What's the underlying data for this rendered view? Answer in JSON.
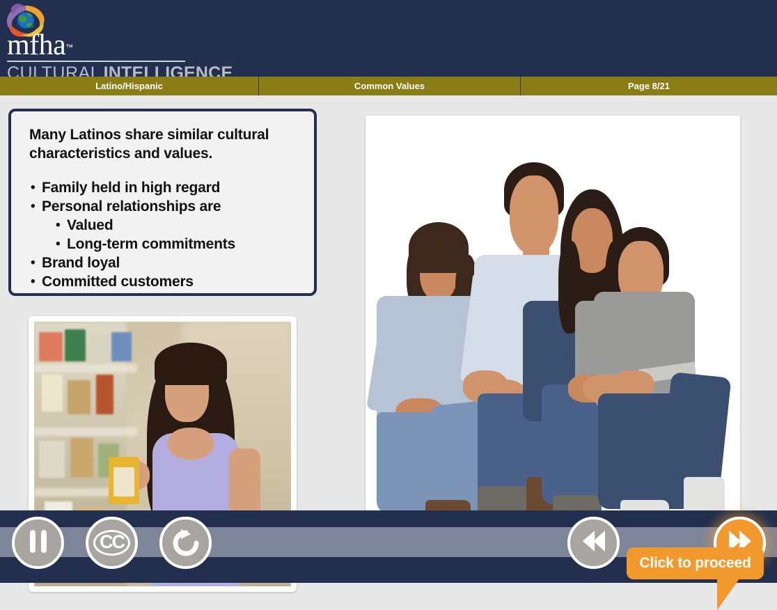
{
  "header": {
    "logo_icon": "mfha-eye-globe-logo",
    "brand_name": "mfha",
    "brand_tm": "™",
    "brand_sub_word1": "CULTURAL",
    "brand_sub_word2": "INTELLIGENCE",
    "bg_color": "#222f4e"
  },
  "navbar": {
    "bg_color": "#8a7d15",
    "segments": [
      {
        "label": "Latino/Hispanic"
      },
      {
        "label": "Common Values"
      },
      {
        "label": "Page 8/21"
      }
    ]
  },
  "content": {
    "bg_color": "#e8e8e8",
    "text_box": {
      "border_color": "#23304f",
      "lead": "Many Latinos share similar cultural characteristics and values.",
      "bullets": [
        {
          "level": 1,
          "text": "Family held in high regard"
        },
        {
          "level": 1,
          "text": "Personal relationships are"
        },
        {
          "level": 2,
          "text": "Valued"
        },
        {
          "level": 2,
          "text": "Long-term commitments"
        },
        {
          "level": 1,
          "text": "Brand loyal"
        },
        {
          "level": 1,
          "text": "Committed customers"
        }
      ]
    },
    "family_photo": {
      "name": "family-of-four-photo"
    },
    "grocery_photo": {
      "name": "woman-shopping-grocery-photo"
    },
    "callout": {
      "label": "Click to proceed",
      "color": "#F2992E"
    }
  },
  "controlbar": {
    "bg_color": "#222f4e",
    "track_color": "#7d8599",
    "buttons": [
      {
        "name": "pause-button",
        "icon": "pause-icon",
        "style": "grey"
      },
      {
        "name": "captions-button",
        "icon": "cc-icon",
        "style": "grey",
        "glyph": "CC"
      },
      {
        "name": "replay-button",
        "icon": "replay-icon",
        "style": "grey"
      },
      {
        "name": "back-button",
        "icon": "rewind-icon",
        "style": "grey"
      },
      {
        "name": "forward-button",
        "icon": "forward-icon",
        "style": "orange"
      }
    ]
  }
}
